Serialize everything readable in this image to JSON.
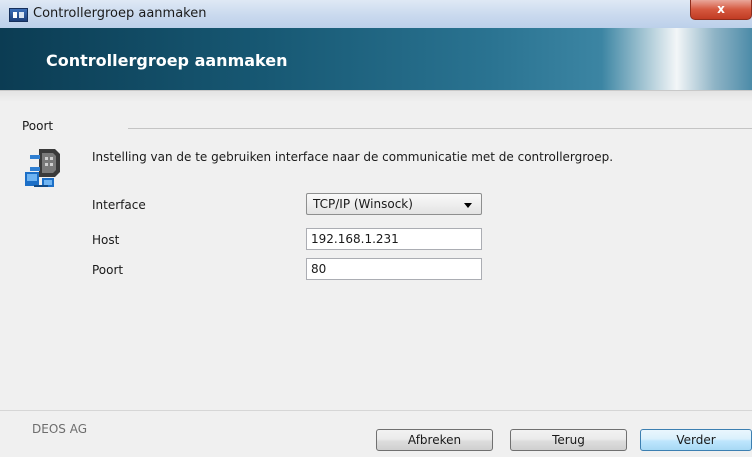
{
  "window": {
    "title": "Controllergroep aanmaken",
    "close_glyph": "x"
  },
  "banner": {
    "title": "Controllergroep aanmaken"
  },
  "section": {
    "label": "Poort",
    "instruction": "Instelling van de te gebruiken interface naar de communicatie met de controllergroep.",
    "icon": "serial-port-network-icon"
  },
  "form": {
    "interface": {
      "label": "Interface",
      "value": "TCP/IP (Winsock)"
    },
    "host": {
      "label": "Host",
      "value": "192.168.1.231"
    },
    "port": {
      "label": "Poort",
      "value": "80"
    }
  },
  "footer": {
    "company": "DEOS AG",
    "buttons": {
      "cancel": "Afbreken",
      "back": "Terug",
      "next": "Verder"
    }
  },
  "colors": {
    "banner_dark": "#0b3c53",
    "close_red": "#c13b23",
    "primary_button": "#bee6fd"
  }
}
